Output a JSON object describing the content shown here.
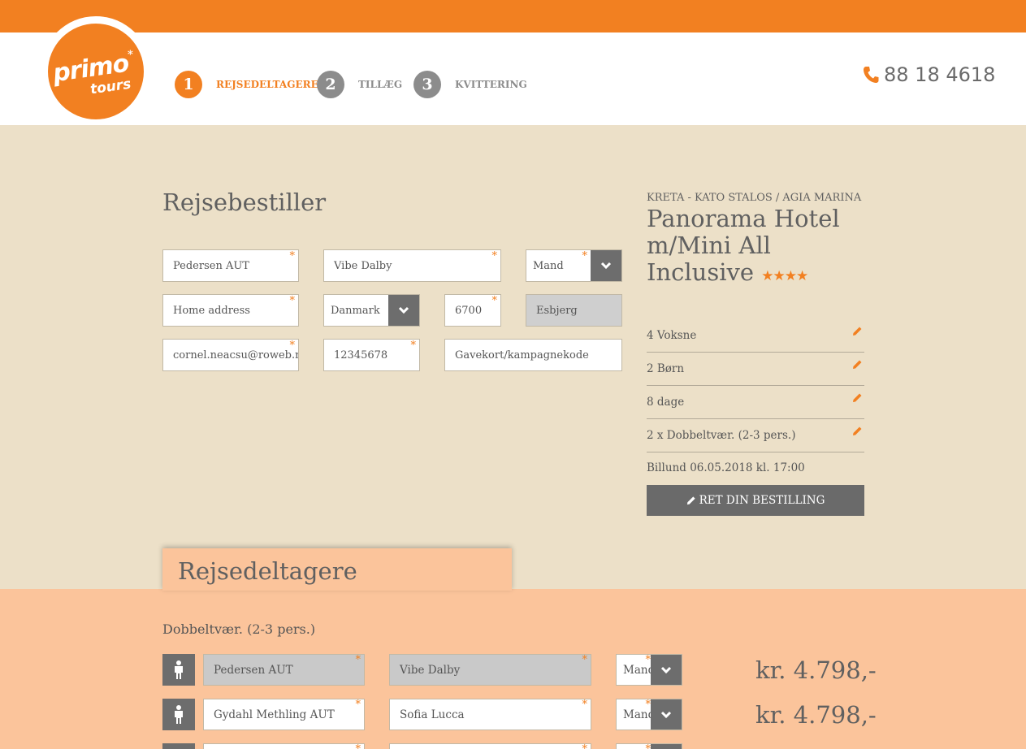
{
  "header": {
    "logo": {
      "word1": "primo",
      "word2": "tours",
      "mark": "*"
    },
    "steps": [
      {
        "num": "1",
        "label": "REJSEDELTAGERE",
        "active": true
      },
      {
        "num": "2",
        "label": "TILLÆG",
        "active": false
      },
      {
        "num": "3",
        "label": "KVITTERING",
        "active": false
      }
    ],
    "phone": "88 18 4618",
    "phone_icon": "phone-icon"
  },
  "form": {
    "title": "Rejsebestiller",
    "first_name": "Pedersen AUT",
    "last_name": "Vibe Dalby",
    "gender": "Mand",
    "address": "Home address",
    "country": "Danmark",
    "zip": "6700",
    "city": "Esbjerg",
    "email": "cornel.neacsu@roweb.rc",
    "phone": "12345678",
    "voucher_placeholder": "Gavekort/kampagnekode"
  },
  "trip": {
    "destination": "KRETA - KATO STALOS / AGIA MARINA",
    "hotel": "Panorama Hotel m/Mini All Inclusive",
    "stars": "★★★★",
    "rating": 4,
    "summary": [
      "4 Voksne",
      "2 Børn",
      "8 dage",
      "2 x Dobbeltvær. (2-3 pers.)"
    ],
    "departure": "Billund 06.05.2018 kl. 17:00",
    "edit_button": "RET DIN BESTILLING"
  },
  "participants": {
    "title": "Rejsedeltagere",
    "room": "Dobbeltvær. (2-3 pers.)",
    "rows": [
      {
        "first": "Pedersen AUT",
        "last": "Vibe Dalby",
        "gender": "Mand",
        "price": "kr. 4.798,-"
      },
      {
        "first": "Gydahl Methling AUT",
        "last": "Sofia Lucca",
        "gender": "Mand",
        "price": "kr. 4.798,-"
      }
    ]
  },
  "colors": {
    "accent": "#f28021",
    "sand": "#ece0c8",
    "peach": "#fbc49b",
    "dark": "#6d6d6d"
  }
}
